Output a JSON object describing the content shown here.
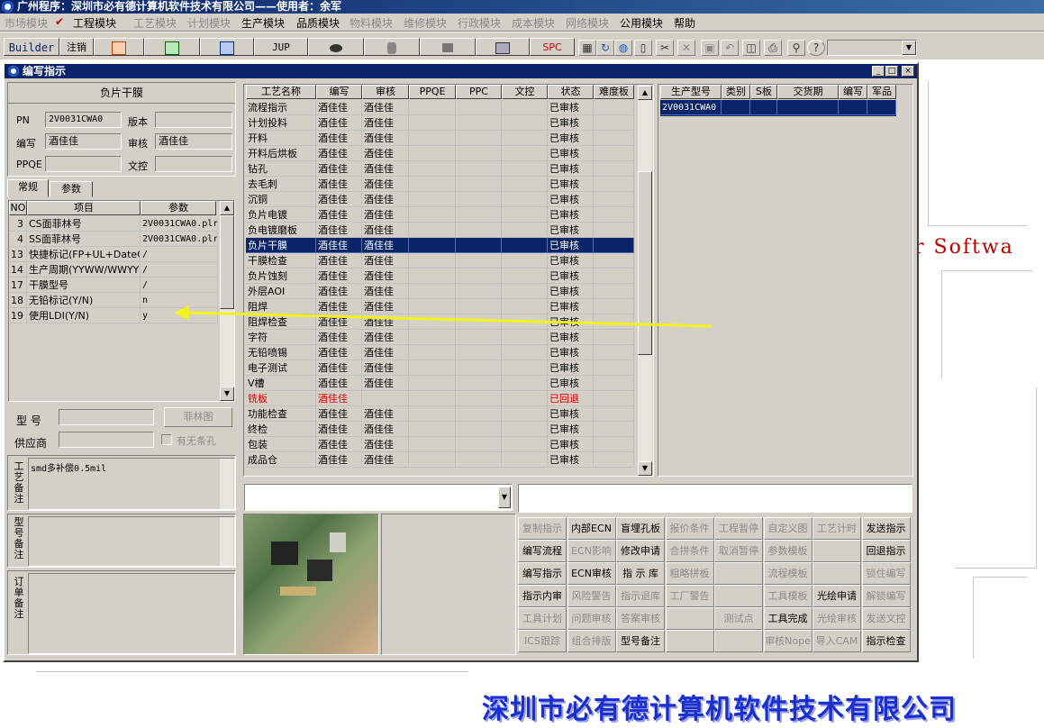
{
  "app_title": "广州程序：深圳市必有德计算机软件技术有限公司——使用者：余军",
  "menu": [
    {
      "label": "市场模块",
      "dim": true
    },
    {
      "label": "✔",
      "dim": false,
      "check": true
    },
    {
      "label": "工程模块",
      "dim": false
    },
    {
      "label": "工艺模块",
      "dim": true
    },
    {
      "label": "计划模块",
      "dim": true
    },
    {
      "label": "生产模块",
      "dim": false
    },
    {
      "label": "品质模块",
      "dim": false
    },
    {
      "label": "物料模块",
      "dim": true
    },
    {
      "label": "维修模块",
      "dim": true
    },
    {
      "label": "行政模块",
      "dim": true
    },
    {
      "label": "成本模块",
      "dim": true
    },
    {
      "label": "网络模块",
      "dim": true
    },
    {
      "label": "公用模块",
      "dim": false
    },
    {
      "label": "帮助",
      "dim": false
    }
  ],
  "toolbar": {
    "builder": "Builder",
    "logout": "注销",
    "jup": "JUP",
    "spc": "SPC"
  },
  "brand_text": "er Softwa",
  "company_banner": "深圳市必有德计算机软件技术有限公司",
  "window": {
    "title": "编写指示",
    "min": "_",
    "max": "□",
    "close": "×"
  },
  "left": {
    "section_title": "负片干膜",
    "pn_label": "PN",
    "pn_value": "2V0031CWA0",
    "version_label": "版本",
    "version_value": "",
    "author_label": "编写",
    "author_value": "酒佳佳",
    "reviewer_label": "审核",
    "reviewer_value": "酒佳佳",
    "ppqe_label": "PPQE",
    "ppqe_value": "",
    "doc_label": "文控",
    "doc_value": "",
    "tabs": [
      "常规",
      "参数"
    ],
    "param_headers": [
      "NO",
      "项目",
      "参数"
    ],
    "params": [
      {
        "no": "3",
        "item": "CS面菲林号",
        "value": "2V0031CWA0.plr"
      },
      {
        "no": "4",
        "item": "SS面菲林号",
        "value": "2V0031CWA0.plr"
      },
      {
        "no": "13",
        "item": "快捷标记(FP+UL+DateC",
        "value": "/"
      },
      {
        "no": "14",
        "item": "生产周期(YYWW/WWYY)",
        "value": "/"
      },
      {
        "no": "17",
        "item": "干膜型号",
        "value": "/"
      },
      {
        "no": "18",
        "item": "无铅标记(Y/N)",
        "value": "n"
      },
      {
        "no": "19",
        "item": "使用LDI(Y/N)",
        "value": "y"
      }
    ],
    "model_label": "型  号",
    "model_value": "",
    "film_btn": "菲林图",
    "supplier_label": "供应商",
    "supplier_value": "",
    "no_hole_label": "有无条孔",
    "process_note_label": "工艺备注",
    "process_note": "smd多补偿0.5mil",
    "model_note_label": "型号备注",
    "model_note": "",
    "order_note_label": "订单备注",
    "order_note": ""
  },
  "process": {
    "headers": [
      "工艺名称",
      "编写",
      "审核",
      "PPQE",
      "PPC",
      "文控",
      "状态",
      "难度板"
    ],
    "rows": [
      {
        "name": "流程指示",
        "author": "酒佳佳",
        "reviewer": "酒佳佳",
        "status": "已审核"
      },
      {
        "name": "计划投料",
        "author": "酒佳佳",
        "reviewer": "酒佳佳",
        "status": "已审核"
      },
      {
        "name": "开料",
        "author": "酒佳佳",
        "reviewer": "酒佳佳",
        "status": "已审核"
      },
      {
        "name": "开料后烘板",
        "author": "酒佳佳",
        "reviewer": "酒佳佳",
        "status": "已审核"
      },
      {
        "name": "钻孔",
        "author": "酒佳佳",
        "reviewer": "酒佳佳",
        "status": "已审核"
      },
      {
        "name": "去毛刺",
        "author": "酒佳佳",
        "reviewer": "酒佳佳",
        "status": "已审核"
      },
      {
        "name": "沉铜",
        "author": "酒佳佳",
        "reviewer": "酒佳佳",
        "status": "已审核"
      },
      {
        "name": "负片电镀",
        "author": "酒佳佳",
        "reviewer": "酒佳佳",
        "status": "已审核"
      },
      {
        "name": "负电镀磨板",
        "author": "酒佳佳",
        "reviewer": "酒佳佳",
        "status": "已审核"
      },
      {
        "name": "负片干膜",
        "author": "酒佳佳",
        "reviewer": "酒佳佳",
        "status": "已审核",
        "selected": true
      },
      {
        "name": "干膜检查",
        "author": "酒佳佳",
        "reviewer": "酒佳佳",
        "status": "已审核"
      },
      {
        "name": "负片蚀刻",
        "author": "酒佳佳",
        "reviewer": "酒佳佳",
        "status": "已审核"
      },
      {
        "name": "外层AOI",
        "author": "酒佳佳",
        "reviewer": "酒佳佳",
        "status": "已审核"
      },
      {
        "name": "阻焊",
        "author": "酒佳佳",
        "reviewer": "酒佳佳",
        "status": "已审核"
      },
      {
        "name": "阻焊检查",
        "author": "酒佳佳",
        "reviewer": "酒佳佳",
        "status": "已审核"
      },
      {
        "name": "字符",
        "author": "酒佳佳",
        "reviewer": "酒佳佳",
        "status": "已审核"
      },
      {
        "name": "无铅喷锡",
        "author": "酒佳佳",
        "reviewer": "酒佳佳",
        "status": "已审核"
      },
      {
        "name": "电子测试",
        "author": "酒佳佳",
        "reviewer": "酒佳佳",
        "status": "已审核"
      },
      {
        "name": "V槽",
        "author": "酒佳佳",
        "reviewer": "酒佳佳",
        "status": "已审核"
      },
      {
        "name": "铣板",
        "author": "酒佳佳",
        "reviewer": "",
        "status": "已回退",
        "red": true
      },
      {
        "name": "功能检查",
        "author": "酒佳佳",
        "reviewer": "酒佳佳",
        "status": "已审核"
      },
      {
        "name": "终检",
        "author": "酒佳佳",
        "reviewer": "酒佳佳",
        "status": "已审核"
      },
      {
        "name": "包装",
        "author": "酒佳佳",
        "reviewer": "酒佳佳",
        "status": "已审核"
      },
      {
        "name": "成品仓",
        "author": "酒佳佳",
        "reviewer": "酒佳佳",
        "status": "已审核"
      }
    ]
  },
  "models": {
    "headers": [
      "生产型号",
      "类别",
      "S板",
      "交货期",
      "编写",
      "军品"
    ],
    "rows": [
      {
        "model": "2V0031CWA0"
      }
    ]
  },
  "combo_value": "",
  "buttons": [
    [
      {
        "t": "复制指示",
        "d": true
      },
      {
        "t": "内部ECN",
        "d": false
      },
      {
        "t": "盲埋孔板",
        "d": false
      },
      {
        "t": "报价条件",
        "d": true
      },
      {
        "t": "工程暂停",
        "d": true
      },
      {
        "t": "自定义图",
        "d": true
      },
      {
        "t": "工艺计时",
        "d": true
      },
      {
        "t": "发送指示",
        "d": false
      }
    ],
    [
      {
        "t": "编写流程",
        "d": false
      },
      {
        "t": "ECN影响",
        "d": true
      },
      {
        "t": "修改申请",
        "d": false
      },
      {
        "t": "合拼条件",
        "d": true
      },
      {
        "t": "取消暂停",
        "d": true
      },
      {
        "t": "参数模板",
        "d": true
      },
      {
        "t": "",
        "d": true
      },
      {
        "t": "回退指示",
        "d": false
      }
    ],
    [
      {
        "t": "编写指示",
        "d": false
      },
      {
        "t": "ECN审核",
        "d": false
      },
      {
        "t": "指 示 库",
        "d": false
      },
      {
        "t": "粗略拼板",
        "d": true
      },
      {
        "t": "",
        "d": true
      },
      {
        "t": "流程模板",
        "d": true
      },
      {
        "t": "",
        "d": true
      },
      {
        "t": "锁住编写",
        "d": true
      }
    ],
    [
      {
        "t": "指示内审",
        "d": false
      },
      {
        "t": "风险警告",
        "d": true
      },
      {
        "t": "指示退库",
        "d": true
      },
      {
        "t": "工厂警告",
        "d": true
      },
      {
        "t": "",
        "d": true
      },
      {
        "t": "工具模板",
        "d": true
      },
      {
        "t": "光绘申请",
        "d": false
      },
      {
        "t": "解锁编写",
        "d": true
      }
    ],
    [
      {
        "t": "工具计划",
        "d": true
      },
      {
        "t": "问题审核",
        "d": true
      },
      {
        "t": "答案审核",
        "d": true
      },
      {
        "t": "",
        "d": true
      },
      {
        "t": "测试点",
        "d": true
      },
      {
        "t": "工具完成",
        "d": false
      },
      {
        "t": "光绘审核",
        "d": true
      },
      {
        "t": "发送文控",
        "d": true
      }
    ],
    [
      {
        "t": "ICS跟踪",
        "d": true
      },
      {
        "t": "组合排版",
        "d": true
      },
      {
        "t": "型号备注",
        "d": false
      },
      {
        "t": "",
        "d": true
      },
      {
        "t": "",
        "d": true
      },
      {
        "t": "审核Nope",
        "d": true
      },
      {
        "t": "导入CAM",
        "d": true
      },
      {
        "t": "指示检查",
        "d": false
      }
    ]
  ],
  "colors": {
    "accent": "#0a246a",
    "arrow": "#f2f21a",
    "face": "#d4d0c8",
    "error": "#e00000"
  }
}
